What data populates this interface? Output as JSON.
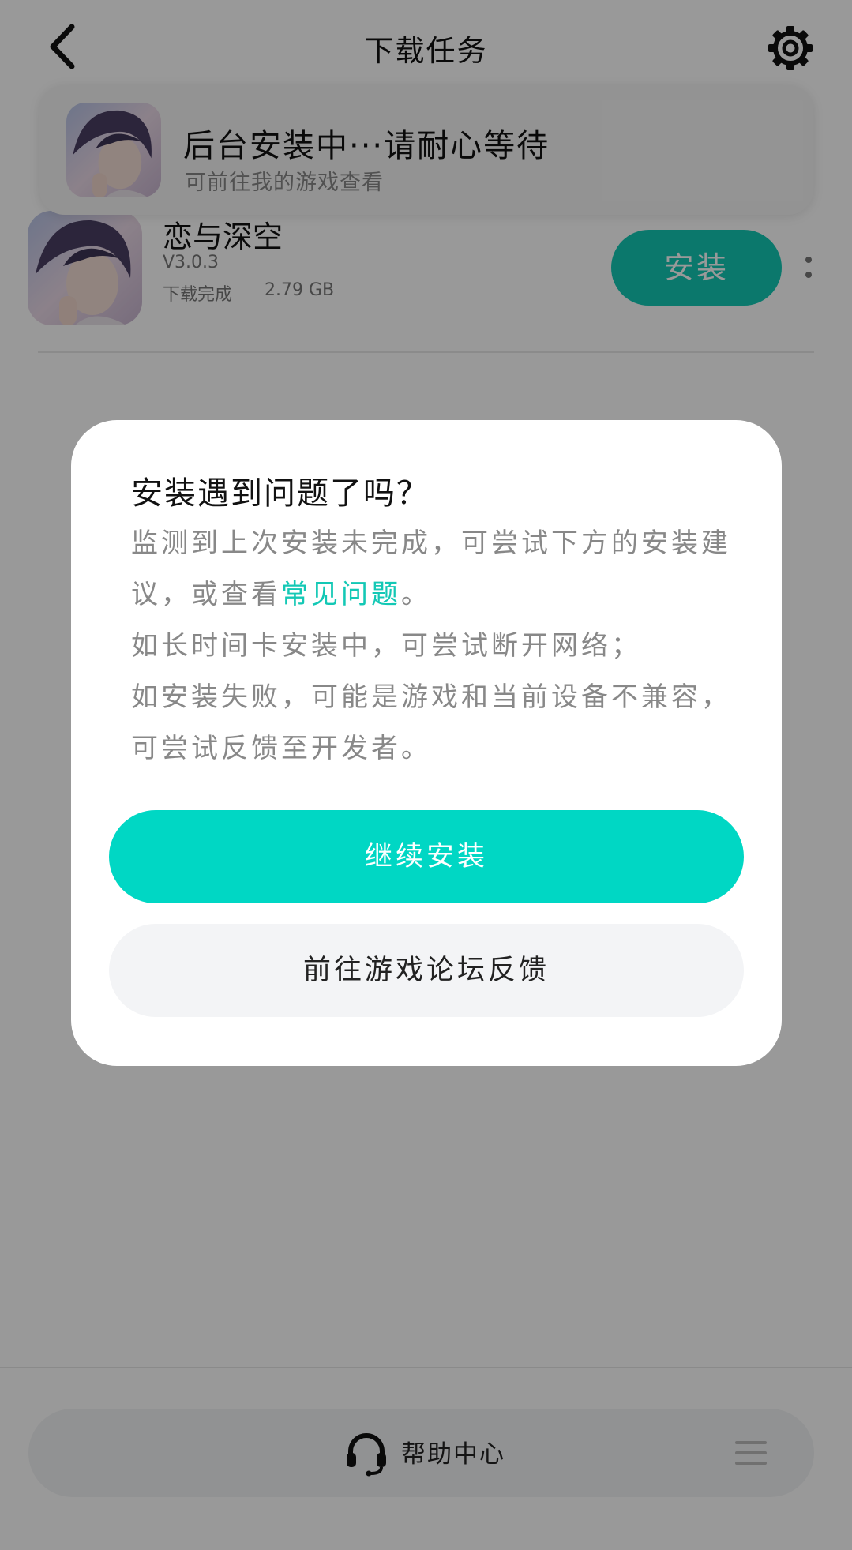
{
  "header": {
    "title": "下载任务"
  },
  "toast": {
    "title": "后台安装中···请耐心等待",
    "subtitle": "可前往我的游戏查看"
  },
  "task": {
    "game_name": "恋与深空",
    "version": "V3.0.3",
    "status": "下载完成",
    "size": "2.79 GB",
    "install_label": "安装"
  },
  "dialog": {
    "title": "安装遇到问题了吗？",
    "body_line1_pre": "监测到上次安装未完成，可尝试下方的安装建议，或查看",
    "faq_link": "常见问题",
    "body_line1_post": "。",
    "body_line2": "如长时间卡安装中，可尝试断开网络；",
    "body_line3": "如安装失败，可能是游戏和当前设备不兼容，可尝试反馈至开发者。",
    "continue_label": "继续安装",
    "forum_label": "前往游戏论坛反馈"
  },
  "bottom": {
    "help_label": "帮助中心"
  },
  "colors": {
    "accent": "#13c8b5",
    "primary_button": "#00d7c4",
    "overlay": "rgba(0,0,0,0.40)"
  },
  "icons": [
    "back-icon",
    "gear-icon",
    "more-icon",
    "headset-icon",
    "menu-icon",
    "game-cover-icon"
  ]
}
